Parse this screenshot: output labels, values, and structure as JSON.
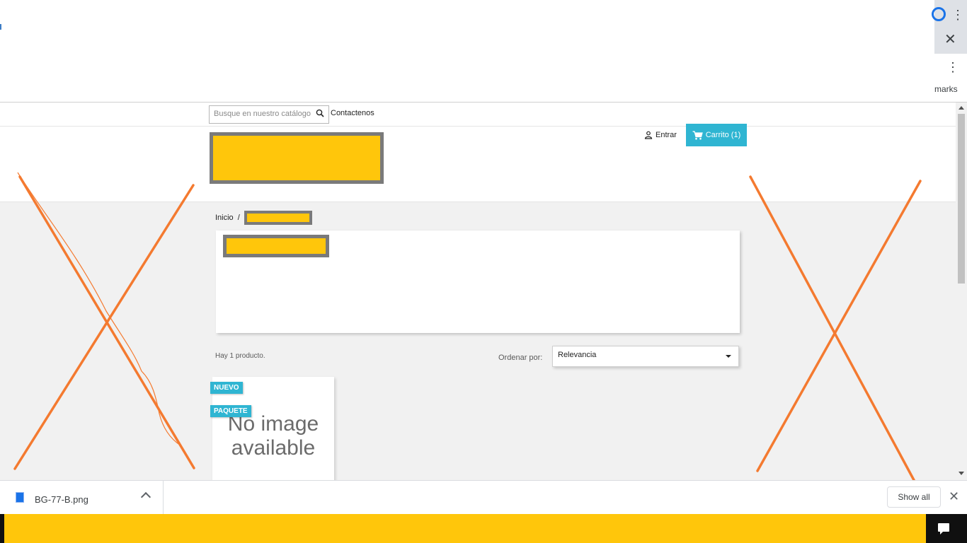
{
  "browser": {
    "bookmarks_fragment": "marks"
  },
  "header": {
    "search_placeholder": "Busque en nuestro catálogo",
    "contact_label": "Contactenos",
    "login_label": "Entrar",
    "cart_label": "Carrito (1)"
  },
  "breadcrumb": {
    "home": "Inicio",
    "separator": "/"
  },
  "listing": {
    "product_count": "Hay 1 producto.",
    "sort_label": "Ordenar por:",
    "sort_value": "Relevancia"
  },
  "product": {
    "badge_new": "NUEVO",
    "badge_pack": "PAQUETE",
    "no_image_line1": "No image",
    "no_image_line2": "available"
  },
  "download_shelf": {
    "file_name": "BG-77-B.png",
    "show_all_label": "Show all"
  },
  "colors": {
    "accent": "#2fb5d2",
    "redaction": "#ffc60b",
    "annotation": "#f47a30"
  }
}
